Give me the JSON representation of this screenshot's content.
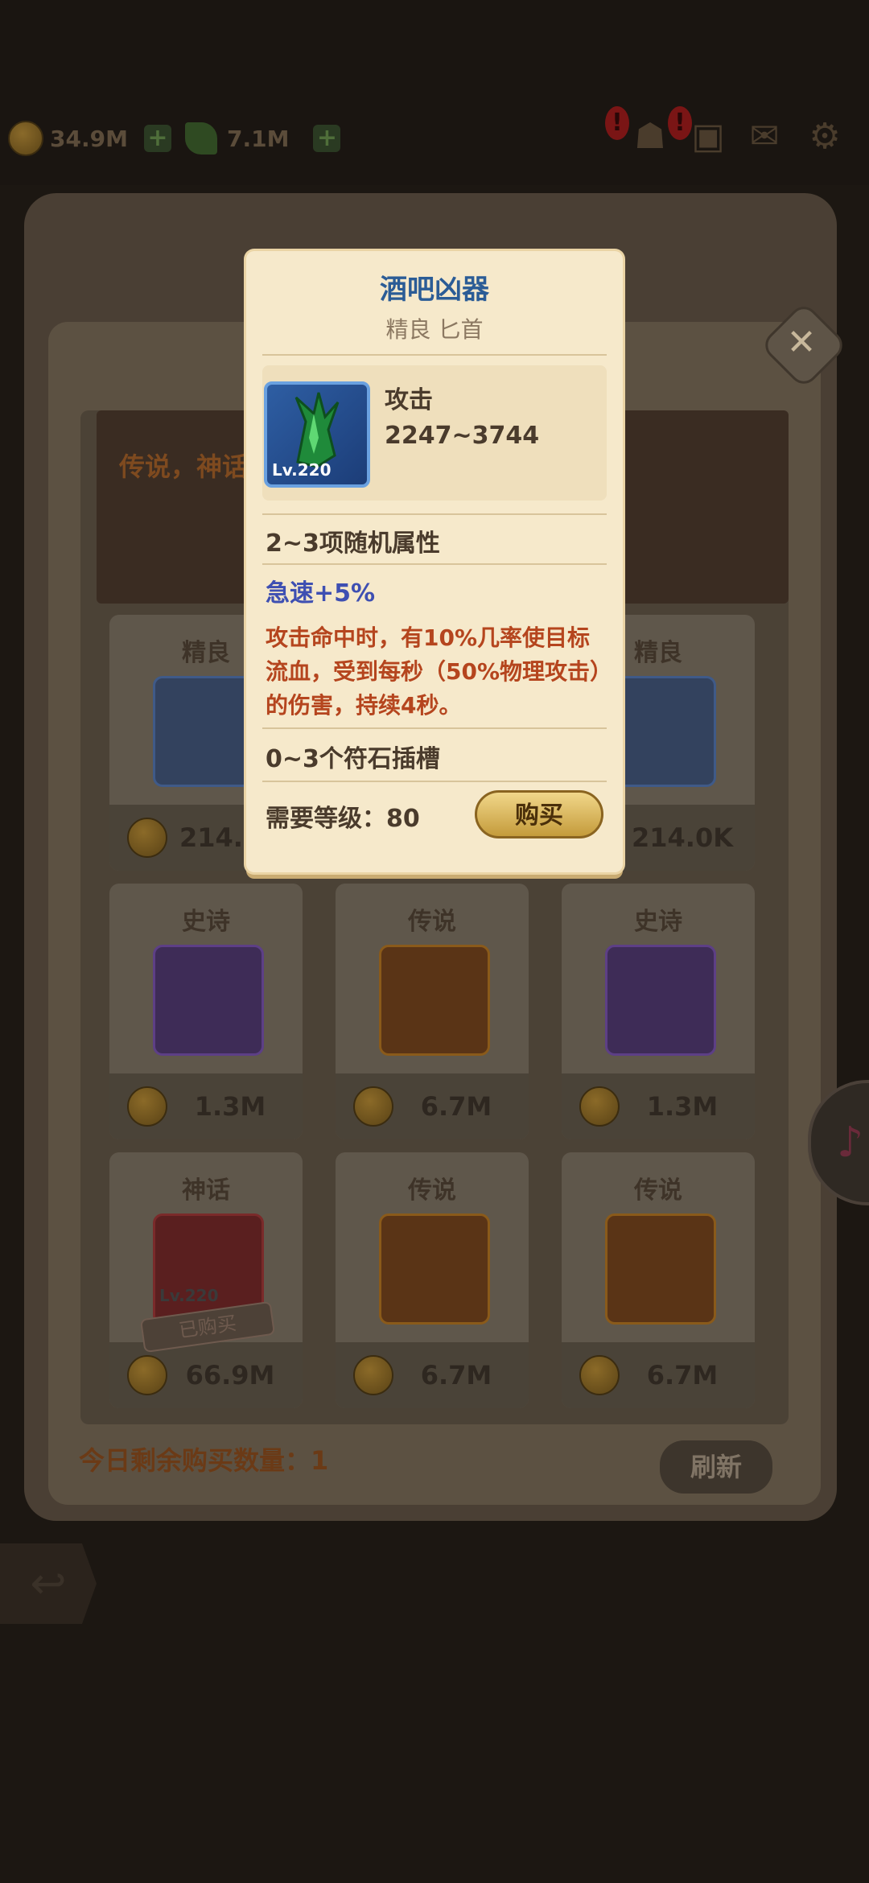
{
  "topbar": {
    "gold": "34.9M",
    "gems": "7.1M"
  },
  "shop": {
    "banner_text": "传说，神话",
    "remaining_label": "今日剩余购买数量：1",
    "refresh_label": "刷新",
    "cards": [
      {
        "rarity": "精良",
        "price": "214.0K",
        "icon": "shield-icon",
        "color": "#33425e"
      },
      {
        "rarity": "",
        "price": "",
        "icon": "",
        "color": "#4f4537"
      },
      {
        "rarity": "精良",
        "price": "214.0K",
        "icon": "green-crystal-dagger-icon",
        "color": "#33425e"
      },
      {
        "rarity": "史诗",
        "price": "1.3M",
        "icon": "sword-icon",
        "color": "#3e2c57"
      },
      {
        "rarity": "传说",
        "price": "6.7M",
        "icon": "pendant-icon",
        "color": "#5a3416"
      },
      {
        "rarity": "史诗",
        "price": "1.3M",
        "icon": "tome-icon",
        "color": "#3e2c57"
      },
      {
        "rarity": "神话",
        "price": "66.9M",
        "icon": "crown-helmet-icon",
        "color": "#5a1f1f",
        "level": "Lv.220",
        "bought": "已购买"
      },
      {
        "rarity": "传说",
        "price": "6.7M",
        "icon": "broadsword-icon",
        "color": "#5a3416"
      },
      {
        "rarity": "传说",
        "price": "6.7M",
        "icon": "iron-helm-icon",
        "color": "#5a3416"
      }
    ]
  },
  "popup": {
    "title": "酒吧凶器",
    "subtitle": "精良 匕首",
    "item_level": "Lv.220",
    "stat_name": "攻击",
    "stat_value": "2247~3744",
    "random_attrs": "2~3项随机属性",
    "bonus": "急速+5%",
    "effect": "攻击命中时，有10%几率使目标流血，受到每秒（50%物理攻击）的伤害，持续4秒。",
    "sockets": "0~3个符石插槽",
    "requirement": "需要等级：80",
    "buy_label": "购买"
  }
}
